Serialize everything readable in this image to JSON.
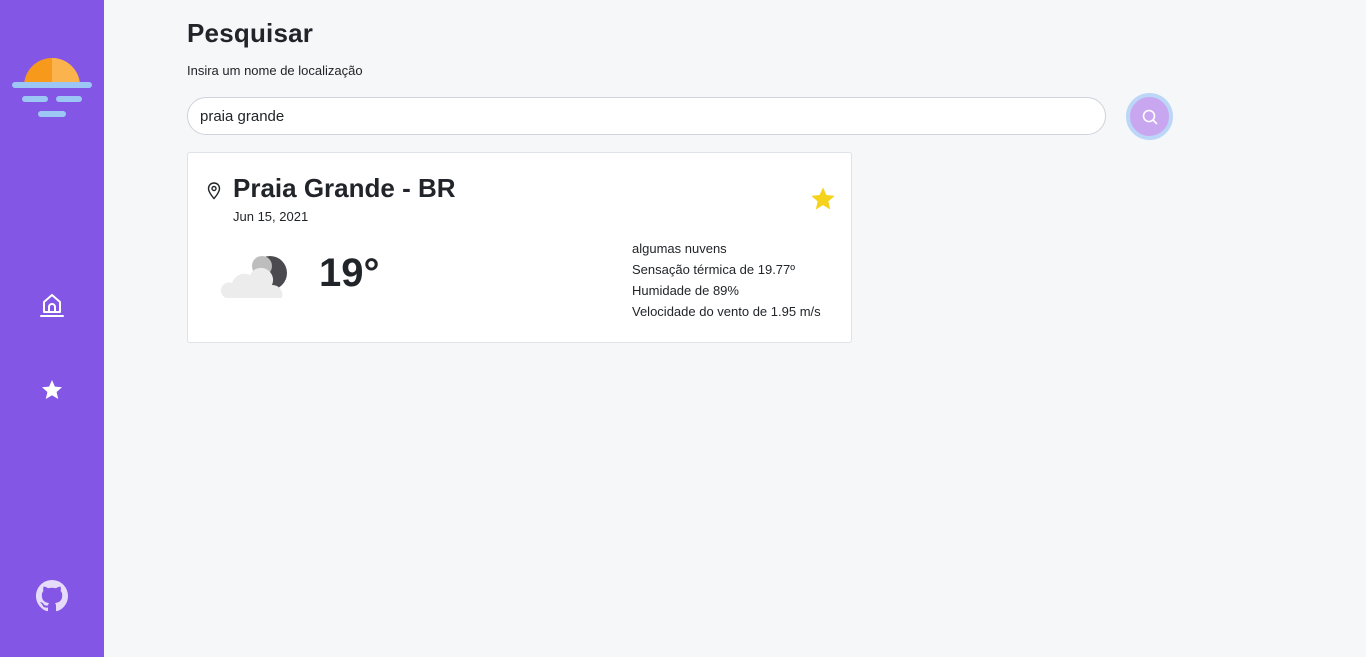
{
  "colors": {
    "sidebar": "#8456e6",
    "background": "#f6f7f9",
    "search_button": "#c9a6f0",
    "search_button_ring": "#bcd6f8",
    "favorite_star": "#f5d31c",
    "logo_sun": "#f79a1c",
    "logo_lines": "#9cc7f5"
  },
  "sidebar": {
    "logo_icon": "sunset-logo-icon",
    "items": [
      {
        "name": "home",
        "icon": "home-icon"
      },
      {
        "name": "favorites",
        "icon": "star-icon"
      }
    ],
    "footer_icon": "github-icon"
  },
  "search": {
    "title": "Pesquisar",
    "subtitle": "Insira um nome de localização",
    "value": "praia grande",
    "button_icon": "search-icon"
  },
  "result": {
    "location_icon": "map-pin-icon",
    "city": "Praia Grande - BR",
    "date": "Jun 15, 2021",
    "favorite_icon": "star-filled-icon",
    "weather_icon": "cloud-moon-icon",
    "temperature": "19°",
    "description": "algumas nuvens",
    "feels_like": "Sensação térmica de 19.77º",
    "humidity": "Humidade de 89%",
    "wind": "Velocidade do vento de 1.95 m/s"
  }
}
